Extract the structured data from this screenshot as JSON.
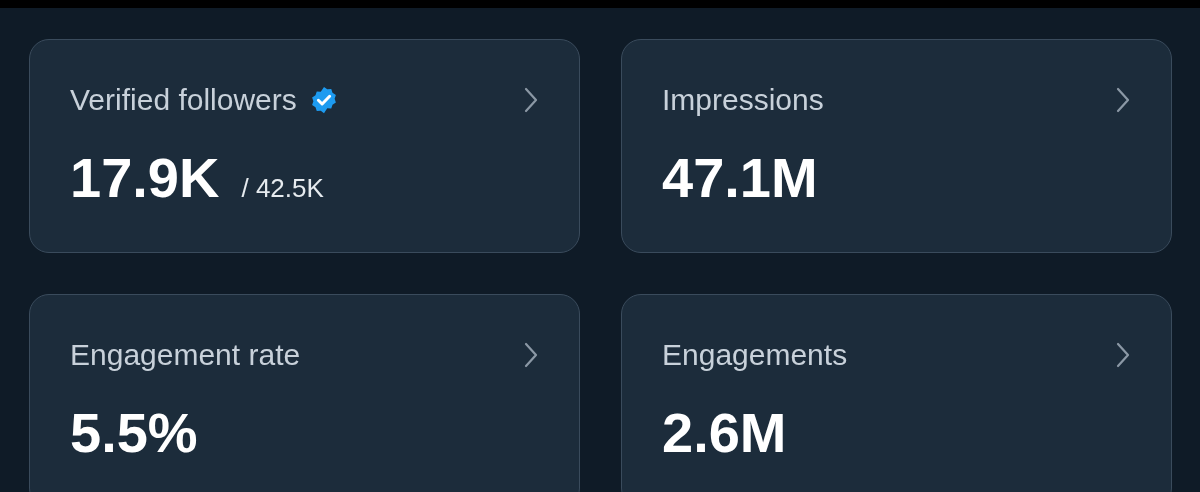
{
  "cards": [
    {
      "title": "Verified followers",
      "verified": true,
      "value": "17.9K",
      "total": "/ 42.5K"
    },
    {
      "title": "Impressions",
      "verified": false,
      "value": "47.1M"
    },
    {
      "title": "Engagement rate",
      "verified": false,
      "value": "5.5%"
    },
    {
      "title": "Engagements",
      "verified": false,
      "value": "2.6M"
    }
  ]
}
